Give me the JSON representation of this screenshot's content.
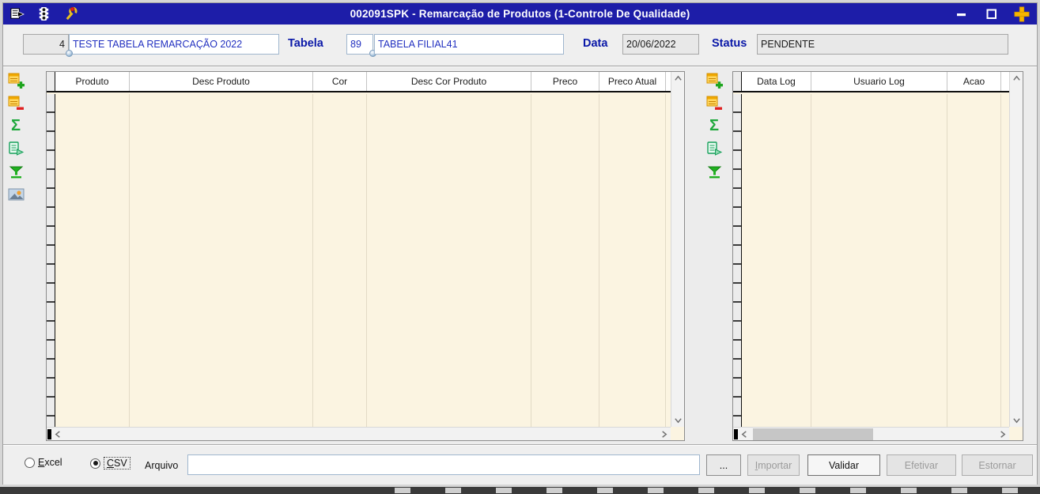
{
  "window": {
    "title": "002091SPK - Remarcação de Produtos (1-Controle De Qualidade)"
  },
  "titlebar": {
    "icons": [
      "exit-icon",
      "traffic-light-icon",
      "wrench-icon"
    ],
    "controls": [
      "minimize-icon",
      "maximize-icon",
      "close-plus-icon"
    ]
  },
  "form": {
    "code_value": "4",
    "name_value": "TESTE TABELA REMARCAÇÃO 2022",
    "tabela_label": "Tabela",
    "tabela_code": "89",
    "tabela_name": "TABELA FILIAL41",
    "data_label": "Data",
    "data_value": "20/06/2022",
    "status_label": "Status",
    "status_value": "PENDENTE"
  },
  "left_grid": {
    "columns": [
      "Produto",
      "Desc Produto",
      "Cor",
      "Desc Cor Produto",
      "Preco",
      "Preco Atual"
    ],
    "rows": []
  },
  "right_grid": {
    "columns": [
      "Data Log",
      "Usuario Log",
      "Acao"
    ],
    "rows": []
  },
  "side_toolbar": {
    "icons": [
      "add-row-icon",
      "delete-row-icon",
      "sum-icon",
      "export-icon",
      "filter-icon",
      "image-icon"
    ]
  },
  "log_toolbar": {
    "icons": [
      "add-row-icon",
      "delete-row-icon",
      "sum-icon",
      "export-icon",
      "filter-icon"
    ]
  },
  "footer": {
    "excel": {
      "first": "E",
      "rest": "xcel"
    },
    "csv": {
      "first": "C",
      "rest": "SV"
    },
    "selected_format": "CSV",
    "arquivo_label": "Arquivo",
    "arquivo_value": "",
    "browse_label": "...",
    "importar": {
      "first": "I",
      "rest": "mportar"
    },
    "validar_label": "Validar",
    "efetivar_label": "Efetivar",
    "estornar_label": "Estornar"
  },
  "colors": {
    "titlebar": "#1D1DA8",
    "grid_body": "#FBF4E1",
    "field_text_blue": "#2230C0",
    "label_blue": "#0A18A8",
    "close_plus_gold": "#F7B500",
    "toolbar_green": "#1FA83C"
  }
}
